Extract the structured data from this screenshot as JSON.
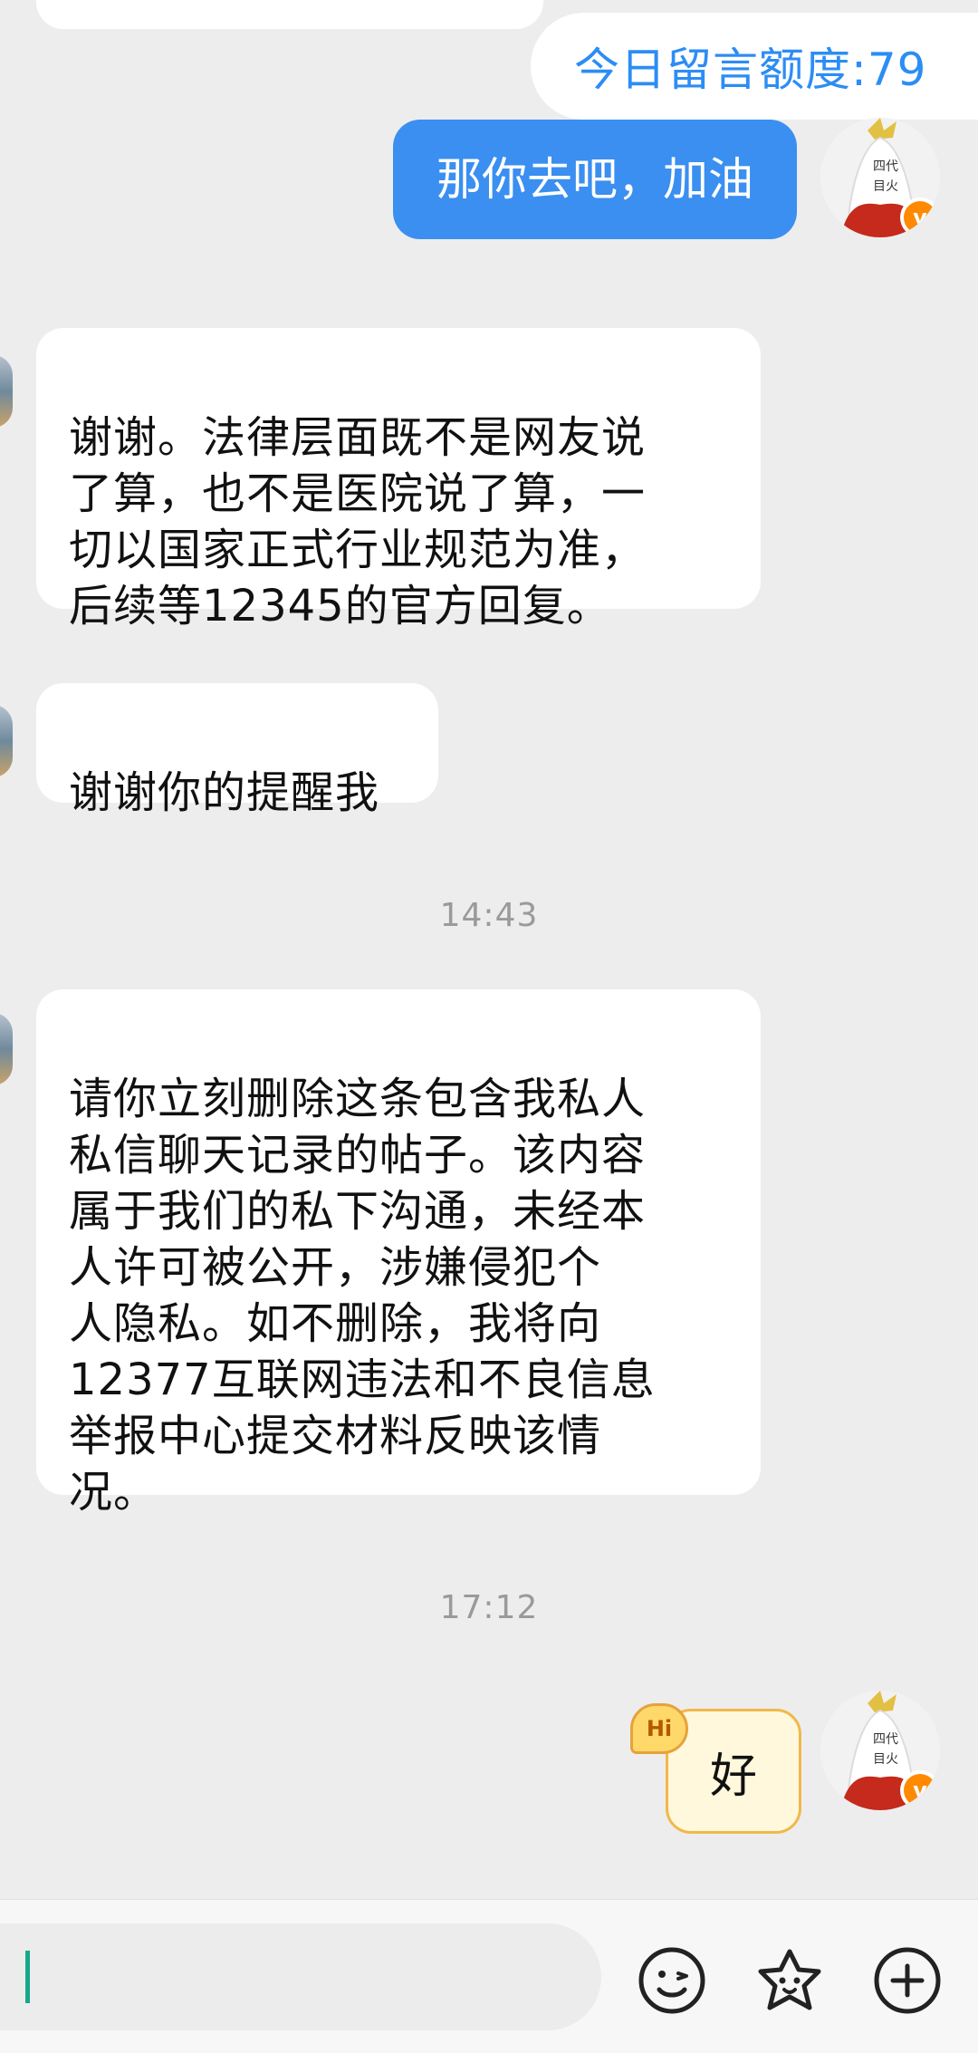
{
  "quota": {
    "label": "今日留言额度:79"
  },
  "messages": [
    {
      "side": "right",
      "text": "那你去吧，加油"
    },
    {
      "side": "left",
      "text": "谢谢。法律层面既不是网友说\n了算，也不是医院说了算，一\n切以国家正式行业规范为准，\n后续等12345的官方回复。"
    },
    {
      "side": "left",
      "text": "谢谢你的提醒我"
    },
    {
      "side": "left",
      "text": "请你立刻删除这条包含我私人\n私信聊天记录的帖子。该内容\n属于我们的私下沟通，未经本\n人许可被公开，涉嫌侵犯个\n人隐私。如不删除，我将向\n12377互联网违法和不良信息\n举报中心提交材料反映该情\n况。"
    },
    {
      "side": "right",
      "text": "好"
    }
  ],
  "timestamps": [
    "14:43",
    "17:12"
  ],
  "sticker_tag": "Hi",
  "avatar_badge": "v",
  "toolbar": {
    "icons": [
      "emoji-icon",
      "sticker-icon",
      "plus-icon"
    ]
  },
  "colors": {
    "sent_bubble": "#3a8ff0",
    "received_bubble": "#ffffff",
    "background": "#ededed",
    "quota_text": "#2c8df4",
    "caret": "#17a88c"
  }
}
